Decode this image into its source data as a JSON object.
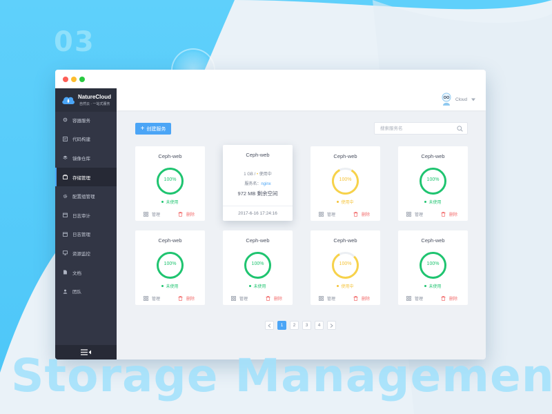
{
  "backdrop": {
    "number": "03",
    "title": "Storage Management"
  },
  "brand": {
    "name": "NatureCloud",
    "tagline": "自然云 · 一站式服务"
  },
  "sidebar": {
    "items": [
      {
        "label": "容器服务",
        "icon": "gear-icon"
      },
      {
        "label": "代码构建",
        "icon": "code-icon"
      },
      {
        "label": "镜像仓库",
        "icon": "layers-icon"
      },
      {
        "label": "存储管理",
        "icon": "storage-icon",
        "active": true
      },
      {
        "label": "配置组管理",
        "icon": "settings-icon"
      },
      {
        "label": "日志审计",
        "icon": "calendar-icon"
      },
      {
        "label": "日志管理",
        "icon": "calendar-icon"
      },
      {
        "label": "资源监控",
        "icon": "monitor-icon"
      },
      {
        "label": "文档",
        "icon": "document-icon"
      },
      {
        "label": "团队",
        "icon": "team-icon"
      }
    ]
  },
  "header": {
    "user_name": "Cloud"
  },
  "toolbar": {
    "create_label": "创建服务",
    "search_placeholder": "搜索服务名"
  },
  "cards": [
    {
      "title": "Ceph-web",
      "percent": "100%",
      "status": "未使用",
      "tone": "green",
      "manage": "管理",
      "delete": "删除"
    },
    {
      "title": "Ceph-web",
      "detail": true,
      "capacity": "1 GB /",
      "in_use": "使用中",
      "service_label": "服务名：",
      "service_name": "nginx",
      "free": "972 MB 剩余空间",
      "timestamp": "2017-6-16 17:24:16"
    },
    {
      "title": "Ceph-web",
      "percent": "100%",
      "status": "使用中",
      "tone": "yellow",
      "manage": "管理",
      "delete": "删除"
    },
    {
      "title": "Ceph-web",
      "percent": "100%",
      "status": "未使用",
      "tone": "green",
      "manage": "管理",
      "delete": "删除"
    },
    {
      "title": "Ceph-web",
      "percent": "100%",
      "status": "未使用",
      "tone": "green",
      "manage": "管理",
      "delete": "删除"
    },
    {
      "title": "Ceph-web",
      "percent": "100%",
      "status": "未使用",
      "tone": "green",
      "manage": "管理",
      "delete": "删除"
    },
    {
      "title": "Ceph-web",
      "percent": "100%",
      "status": "使用中",
      "tone": "yellow",
      "manage": "管理",
      "delete": "删除"
    },
    {
      "title": "Ceph-web",
      "percent": "100%",
      "status": "未使用",
      "tone": "green",
      "manage": "管理",
      "delete": "删除"
    }
  ],
  "pagination": {
    "pages": [
      "1",
      "2",
      "3",
      "4"
    ],
    "current": "1"
  },
  "colors": {
    "accent": "#4ba5f6",
    "green": "#1fc470",
    "yellow": "#f7d24a",
    "danger": "#f26d6d",
    "sidebar": "#323645"
  }
}
